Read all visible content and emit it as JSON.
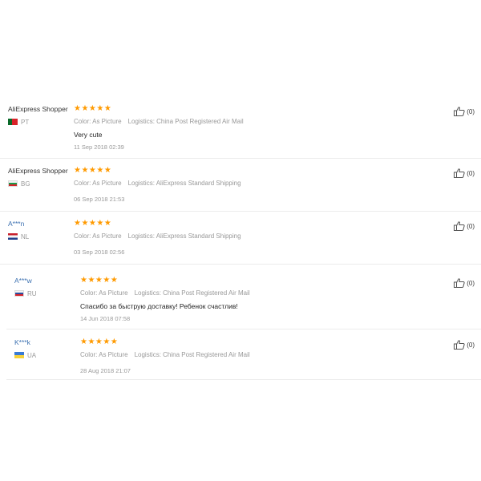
{
  "reviews": [
    {
      "user": "AliExpress Shopper",
      "country": "PT",
      "stars": "★★★★★",
      "color": "Color: As Picture",
      "logistics": "Logistics: China Post Registered Air Mail",
      "text": "Very cute",
      "date": "11 Sep 2018 02:39",
      "helpful": "(0)"
    },
    {
      "user": "AliExpress Shopper",
      "country": "BG",
      "stars": "★★★★★",
      "color": "Color: As Picture",
      "logistics": "Logistics: AliExpress Standard Shipping",
      "text": "",
      "date": "06 Sep 2018 21:53",
      "helpful": "(0)"
    },
    {
      "user": "A***n",
      "country": "NL",
      "stars": "★★★★★",
      "color": "Color: As Picture",
      "logistics": "Logistics: AliExpress Standard Shipping",
      "text": "",
      "date": "03 Sep 2018 02:56",
      "helpful": "(0)"
    },
    {
      "user": "A***w",
      "country": "RU",
      "stars": "★★★★★",
      "color": "Color: As Picture",
      "logistics": "Logistics: China Post Registered Air Mail",
      "text": "Спасибо за быструю доставку! Ребенок счастлив!",
      "date": "14 Jun 2018 07:58",
      "helpful": "(0)"
    },
    {
      "user": "K***k",
      "country": "UA",
      "stars": "★★★★★",
      "color": "Color: As Picture",
      "logistics": "Logistics: China Post Registered Air Mail",
      "text": "",
      "date": "28 Aug 2018 21:07",
      "helpful": "(0)"
    }
  ],
  "colors": {
    "star": "#ff9a00",
    "masked_user": "#3a6fb0",
    "meta_text": "#999999"
  },
  "icons": {
    "helpful": "thumbs-up-icon"
  }
}
